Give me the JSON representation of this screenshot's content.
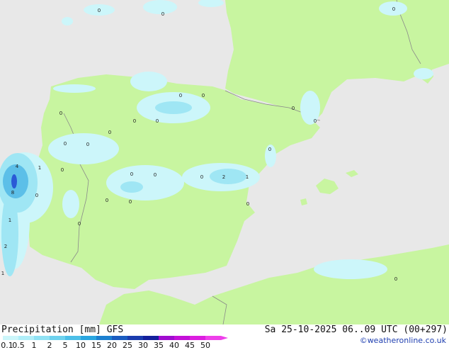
{
  "footer": {
    "title_left": "Precipitation [mm]",
    "model": "GFS",
    "valid_time": "Sa 25-10-2025 06..09 UTC (00+297)",
    "credit": "©weatheronline.co.uk"
  },
  "legend": {
    "labels": [
      "0.1",
      "0.5",
      "1",
      "2",
      "5",
      "10",
      "15",
      "20",
      "25",
      "30",
      "35",
      "40",
      "45",
      "50"
    ],
    "colors": [
      "#ccf6fa",
      "#b0eef8",
      "#90e2f4",
      "#6ed2ee",
      "#4cbfe8",
      "#2aa6e0",
      "#1c80d0",
      "#1a5cc0",
      "#1a3cae",
      "#14209c",
      "#a00ccf",
      "#c410d8",
      "#dc1ee0",
      "#ee40ea"
    ]
  },
  "map": {
    "colors": {
      "sea": "#e8e8e8",
      "land": "#c8f5a0",
      "border": "#8a8a8a",
      "precip_light": "#ccf6fa",
      "precip_med": "#9fe6f4",
      "precip_heavy": "#5cbfe8",
      "precip_max": "#2a5ad6"
    },
    "value_labels": [
      "0",
      "0",
      "0",
      "0",
      "0",
      "0",
      "0",
      "0",
      "0",
      "0",
      "0",
      "0",
      "4",
      "1",
      "0",
      "8",
      "0",
      "1",
      "2",
      "1",
      "0",
      "0",
      "0",
      "0",
      "0",
      "0",
      "0",
      "0",
      "2",
      "1",
      "0",
      "0"
    ]
  }
}
